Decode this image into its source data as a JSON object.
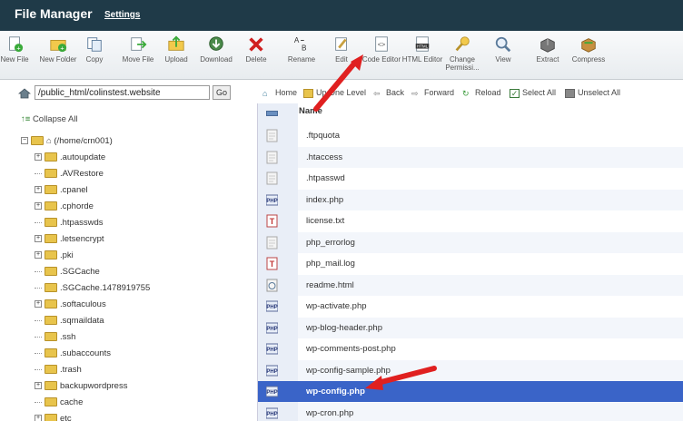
{
  "header": {
    "title": "File Manager",
    "settings_label": "Settings"
  },
  "toolbar": {
    "items": [
      {
        "label": "New File",
        "icon": "new-file-icon"
      },
      {
        "label": "New Folder",
        "icon": "new-folder-icon"
      },
      {
        "label": "Copy",
        "icon": "copy-icon"
      },
      {
        "label": "Move File",
        "icon": "move-file-icon"
      },
      {
        "label": "Upload",
        "icon": "upload-icon"
      },
      {
        "label": "Download",
        "icon": "download-icon"
      },
      {
        "label": "Delete",
        "icon": "delete-icon"
      },
      {
        "label": "Rename",
        "icon": "rename-icon"
      },
      {
        "label": "Edit",
        "icon": "edit-icon"
      },
      {
        "label": "Code Editor",
        "icon": "code-editor-icon"
      },
      {
        "label": "HTML Editor",
        "icon": "html-editor-icon"
      },
      {
        "label": "Change Permissi...",
        "icon": "permissions-icon"
      },
      {
        "label": "View",
        "icon": "view-icon"
      },
      {
        "label": "Extract",
        "icon": "extract-icon"
      },
      {
        "label": "Compress",
        "icon": "compress-icon"
      }
    ]
  },
  "path": {
    "value": "/public_html/colinstest.website",
    "go_label": "Go"
  },
  "tree": {
    "collapse_label": "Collapse All",
    "root_label": "(/home/crn001)",
    "items": [
      {
        "label": ".autoupdate",
        "expandable": true
      },
      {
        "label": ".AVRestore",
        "expandable": false
      },
      {
        "label": ".cpanel",
        "expandable": true
      },
      {
        "label": ".cphorde",
        "expandable": true
      },
      {
        "label": ".htpasswds",
        "expandable": false
      },
      {
        "label": ".letsencrypt",
        "expandable": true
      },
      {
        "label": ".pki",
        "expandable": true
      },
      {
        "label": ".SGCache",
        "expandable": false
      },
      {
        "label": ".SGCache.1478919755",
        "expandable": false
      },
      {
        "label": ".softaculous",
        "expandable": true
      },
      {
        "label": ".sqmaildata",
        "expandable": false
      },
      {
        "label": ".ssh",
        "expandable": false
      },
      {
        "label": ".subaccounts",
        "expandable": false
      },
      {
        "label": ".trash",
        "expandable": false
      },
      {
        "label": "backupwordpress",
        "expandable": true
      },
      {
        "label": "cache",
        "expandable": false
      },
      {
        "label": "etc",
        "expandable": true
      }
    ]
  },
  "nav": {
    "home": "Home",
    "up": "Up One Level",
    "back": "Back",
    "forward": "Forward",
    "reload": "Reload",
    "select_all": "Select All",
    "unselect_all": "Unselect All"
  },
  "files": {
    "column_name": "Name",
    "items": [
      {
        "name": ".ftpquota",
        "type": "generic"
      },
      {
        "name": ".htaccess",
        "type": "generic"
      },
      {
        "name": ".htpasswd",
        "type": "generic"
      },
      {
        "name": "index.php",
        "type": "php"
      },
      {
        "name": "license.txt",
        "type": "text"
      },
      {
        "name": "php_errorlog",
        "type": "generic"
      },
      {
        "name": "php_mail.log",
        "type": "text"
      },
      {
        "name": "readme.html",
        "type": "html"
      },
      {
        "name": "wp-activate.php",
        "type": "php"
      },
      {
        "name": "wp-blog-header.php",
        "type": "php"
      },
      {
        "name": "wp-comments-post.php",
        "type": "php"
      },
      {
        "name": "wp-config-sample.php",
        "type": "php"
      },
      {
        "name": "wp-config.php",
        "type": "php",
        "selected": true
      },
      {
        "name": "wp-cron.php",
        "type": "php"
      }
    ]
  },
  "colors": {
    "header_bg": "#1f3a48",
    "selected_row": "#3a64c8",
    "annotation_arrow": "#e02020"
  }
}
